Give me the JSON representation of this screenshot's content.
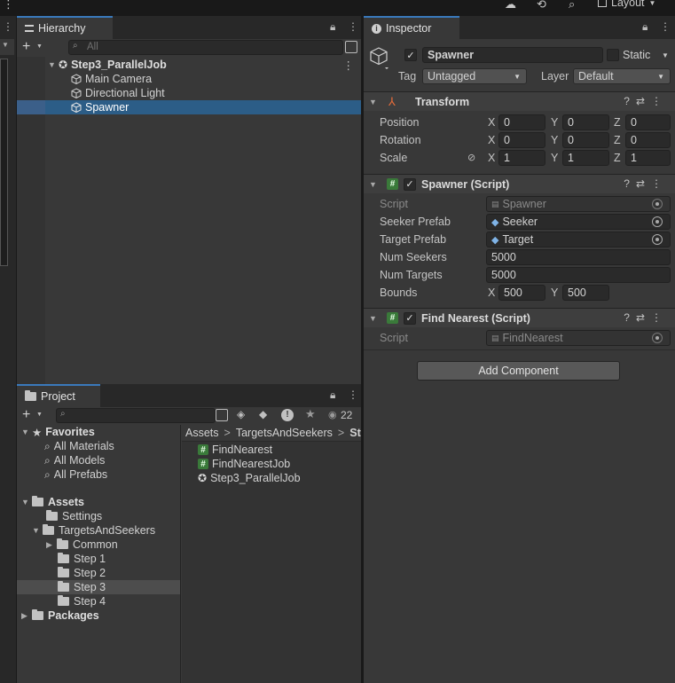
{
  "toolbar": {
    "layout_label": "Layout"
  },
  "hierarchy": {
    "tab_label": "Hierarchy",
    "search_placeholder": "All",
    "scene_name": "Step3_ParallelJob",
    "items": [
      {
        "label": "Main Camera"
      },
      {
        "label": "Directional Light"
      },
      {
        "label": "Spawner",
        "selected": true
      }
    ]
  },
  "inspector": {
    "tab_label": "Inspector",
    "object_name": "Spawner",
    "static_label": "Static",
    "tag_label": "Tag",
    "tag_value": "Untagged",
    "layer_label": "Layer",
    "layer_value": "Default",
    "transform": {
      "title": "Transform",
      "position_label": "Position",
      "rotation_label": "Rotation",
      "scale_label": "Scale",
      "position": {
        "x": "0",
        "y": "0",
        "z": "0"
      },
      "rotation": {
        "x": "0",
        "y": "0",
        "z": "0"
      },
      "scale": {
        "x": "1",
        "y": "1",
        "z": "1"
      }
    },
    "axis": {
      "x": "X",
      "y": "Y",
      "z": "Z"
    },
    "spawner": {
      "title": "Spawner (Script)",
      "script_label": "Script",
      "script_value": "Spawner",
      "seeker_prefab_label": "Seeker Prefab",
      "seeker_prefab_value": "Seeker",
      "target_prefab_label": "Target Prefab",
      "target_prefab_value": "Target",
      "num_seekers_label": "Num Seekers",
      "num_seekers_value": "5000",
      "num_targets_label": "Num Targets",
      "num_targets_value": "5000",
      "bounds_label": "Bounds",
      "bounds_x": "500",
      "bounds_y": "500"
    },
    "find_nearest": {
      "title": "Find Nearest (Script)",
      "script_label": "Script",
      "script_value": "FindNearest"
    },
    "add_component_label": "Add Component"
  },
  "project": {
    "tab_label": "Project",
    "hidden_count": "22",
    "favorites_label": "Favorites",
    "favorites": [
      "All Materials",
      "All Models",
      "All Prefabs"
    ],
    "assets_label": "Assets",
    "settings_label": "Settings",
    "targets_label": "TargetsAndSeekers",
    "common_label": "Common",
    "steps": [
      "Step 1",
      "Step 2",
      "Step 3",
      "Step 4"
    ],
    "packages_label": "Packages",
    "breadcrumb": {
      "root": "Assets",
      "sep": ">",
      "folder": "TargetsAndSeekers",
      "current": "St"
    },
    "files": [
      "FindNearest",
      "FindNearestJob",
      "Step3_ParallelJob"
    ]
  },
  "colors": {
    "selection": "#2c5d87",
    "tab_accent": "#3a79bb",
    "panel": "#383838",
    "script_icon": "#3a7a3a"
  }
}
